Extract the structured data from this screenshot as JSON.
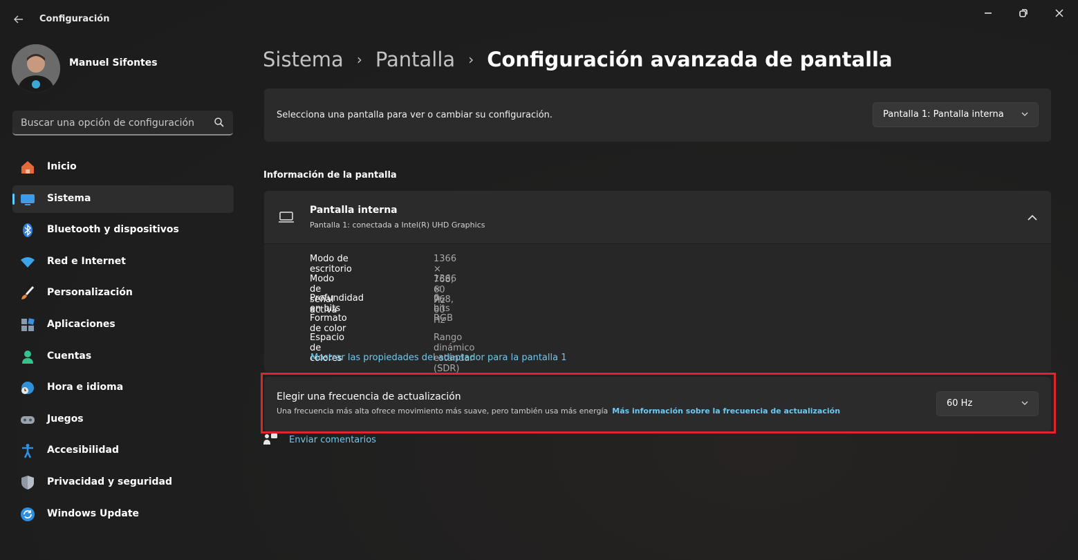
{
  "app": {
    "title": "Configuración"
  },
  "user": {
    "name": "Manuel Sifontes"
  },
  "search": {
    "placeholder": "Buscar una opción de configuración"
  },
  "sidebar": {
    "items": [
      {
        "label": "Inicio",
        "icon": "home-icon"
      },
      {
        "label": "Sistema",
        "icon": "system-monitor-icon",
        "active": true
      },
      {
        "label": "Bluetooth y dispositivos",
        "icon": "bluetooth-icon"
      },
      {
        "label": "Red e Internet",
        "icon": "wifi-icon"
      },
      {
        "label": "Personalización",
        "icon": "paintbrush-icon"
      },
      {
        "label": "Aplicaciones",
        "icon": "apps-icon"
      },
      {
        "label": "Cuentas",
        "icon": "person-icon"
      },
      {
        "label": "Hora e idioma",
        "icon": "globe-clock-icon"
      },
      {
        "label": "Juegos",
        "icon": "gamepad-icon"
      },
      {
        "label": "Accesibilidad",
        "icon": "accessibility-icon"
      },
      {
        "label": "Privacidad y seguridad",
        "icon": "shield-icon"
      },
      {
        "label": "Windows Update",
        "icon": "update-icon"
      }
    ]
  },
  "breadcrumb": {
    "items": [
      "Sistema",
      "Pantalla"
    ],
    "current": "Configuración avanzada de pantalla"
  },
  "display_select": {
    "text": "Selecciona una pantalla para ver o cambiar su configuración.",
    "value": "Pantalla 1: Pantalla interna"
  },
  "display_info": {
    "section_title": "Información de la pantalla",
    "title": "Pantalla interna",
    "subtitle": "Pantalla 1: conectada a Intel(R) UHD Graphics",
    "properties": [
      {
        "label": "Modo de escritorio",
        "value": "1366 × 768, 60 Hz"
      },
      {
        "label": "Modo de señal activa",
        "value": "1366 × 768, 60 Hz"
      },
      {
        "label": "Profundidad en bits",
        "value": "6 bits"
      },
      {
        "label": "Formato de color",
        "value": "RGB"
      },
      {
        "label": "Espacio de colores",
        "value": "Rango dinámico estándar (SDR)"
      }
    ],
    "adapter_link": "Mostrar las propiedades del adaptador para la pantalla 1"
  },
  "refresh_rate": {
    "title": "Elegir una frecuencia de actualización",
    "description": "Una frecuencia más alta ofrece movimiento más suave, pero también usa más energía",
    "link": "Más información sobre la frecuencia de actualización",
    "value": "60 Hz"
  },
  "feedback": {
    "label": "Enviar comentarios"
  },
  "colors": {
    "accent": "#60cdff",
    "link": "#6fc8f0",
    "highlight": "#e0242b"
  }
}
